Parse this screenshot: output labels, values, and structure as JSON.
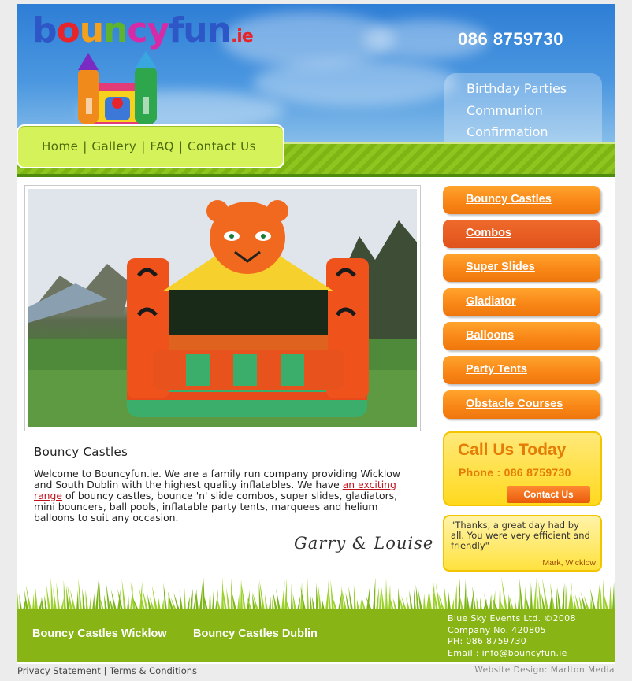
{
  "header": {
    "logo": {
      "part1": "b",
      "part2": "o",
      "part3": "u",
      "part4": "n",
      "part5": "cy",
      "part6": "fun",
      "suffix": ".ie"
    },
    "phone": "086 8759730",
    "services": [
      "Birthday Parties",
      "Communion",
      "Confirmation"
    ]
  },
  "nav": {
    "items": [
      "Home",
      "Gallery",
      "FAQ",
      "Contact Us"
    ],
    "separator": "|"
  },
  "main": {
    "title": "Bouncy Castles",
    "intro_before": "Welcome to Bouncyfun.ie.  We are a family run company providing Wicklow and South Dublin with the highest quality inflatables. We have ",
    "intro_link": "an exciting range",
    "intro_after": " of bouncy castles, bounce 'n' slide combos, super slides, gladiators, mini bouncers, ball pools, inflatable party tents, marquees and helium balloons to suit any occasion.",
    "signature": "Garry & Louise"
  },
  "sidebar": {
    "items": [
      "Bouncy Castles",
      "Combos",
      "Super Slides",
      "Gladiator",
      "Balloons",
      "Party Tents",
      "Obstacle Courses"
    ],
    "call_box": {
      "title": "Call Us Today",
      "phone": "Phone : 086 8759730",
      "button": "Contact Us"
    },
    "testimonial": {
      "quote": "\"Thanks, a great day had by all. You were very efficient and friendly\"",
      "author": "Mark, Wicklow"
    }
  },
  "footer": {
    "links": [
      "Bouncy Castles Wicklow",
      "Bouncy Castles Dublin"
    ],
    "company_lines": [
      "Blue Sky Events Ltd. ©2008",
      "Company No. 420805",
      "PH: 086 8759730"
    ],
    "email_label": "Email : ",
    "email": "info@bouncyfun.ie"
  },
  "bottom_bar": {
    "privacy": "Privacy Statement",
    "separator": "|",
    "terms": "Terms & Conditions",
    "credit": "Website Design: Marlton Media"
  },
  "colors": {
    "sky": "#2e7ed6",
    "accent_orange": "#f98717",
    "nav_green": "#d6f25a",
    "footer_green": "#88b515"
  }
}
